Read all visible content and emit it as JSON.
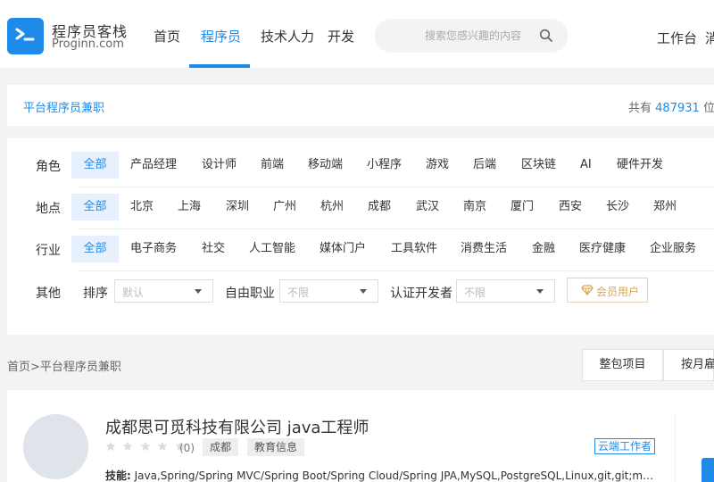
{
  "brand": {
    "name": "程序员客栈",
    "domain": "Proginn.com",
    "color": "#1e8bea",
    "icon": "terminal-prompt-icon"
  },
  "nav": {
    "items": [
      {
        "label": "首页",
        "active": false
      },
      {
        "label": "程序员",
        "active": true
      },
      {
        "label": "技术人力",
        "active": false
      },
      {
        "label": "开发",
        "active": false
      }
    ]
  },
  "search": {
    "placeholder": "搜索您感兴趣的内容",
    "icon": "search-icon"
  },
  "header_right": {
    "workbench": "工作台",
    "more": "消"
  },
  "section": {
    "title": "平台程序员兼职",
    "total_prefix": "共有",
    "total_count": "487931",
    "total_suffix": "位"
  },
  "filters": {
    "role": {
      "label": "角色",
      "options": [
        "全部",
        "产品经理",
        "设计师",
        "前端",
        "移动端",
        "小程序",
        "游戏",
        "后端",
        "区块链",
        "AI",
        "硬件开发"
      ],
      "selected": "全部"
    },
    "location": {
      "label": "地点",
      "options": [
        "全部",
        "北京",
        "上海",
        "深圳",
        "广州",
        "杭州",
        "成都",
        "武汉",
        "南京",
        "厦门",
        "西安",
        "长沙",
        "郑州"
      ],
      "selected": "全部"
    },
    "industry": {
      "label": "行业",
      "options": [
        "全部",
        "电子商务",
        "社交",
        "人工智能",
        "媒体门户",
        "工具软件",
        "消费生活",
        "金融",
        "医疗健康",
        "企业服务"
      ],
      "selected": "全部"
    },
    "other": {
      "label": "其他",
      "sort_label": "排序",
      "sort_value": "默认",
      "freelance_label": "自由职业",
      "freelance_value": "不限",
      "certified_label": "认证开发者",
      "certified_value": "不限",
      "vip_label": "会员用户",
      "vip_icon": "diamond-icon"
    }
  },
  "breadcrumb": {
    "home": "首页",
    "separator": ">",
    "current": "平台程序员兼职"
  },
  "mode_tabs": [
    "整包项目",
    "按月雇"
  ],
  "listing": {
    "title": "成都思可觅科技有限公司  java工程师",
    "rating_stars": 0,
    "rating_max": 5,
    "rating_count": "(0)",
    "tags": [
      "成都",
      "教育信息"
    ],
    "badge": "云端工作者",
    "skills_label": "技能:",
    "skills": "Java,Spring/Spring MVC/Spring Boot/Spring Cloud/Spring JPA,MySQL,PostgreSQL,Linux,git,git;maven,Redis,Docker"
  }
}
